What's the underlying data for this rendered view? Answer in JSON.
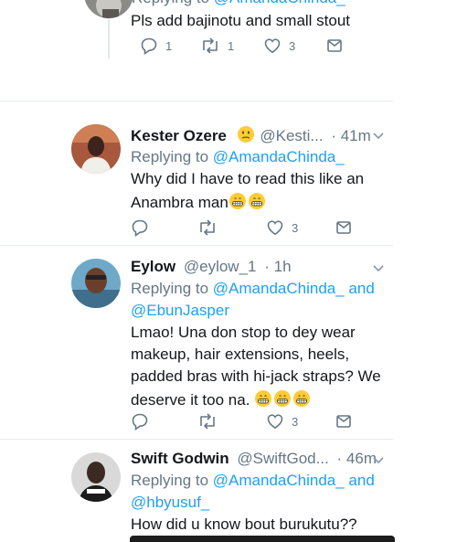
{
  "tweets": [
    {
      "body_lines": [
        "Pls add bajinotu and small stout"
      ],
      "reply_counts": {
        "replies": "1",
        "retweets": "1",
        "likes": "3"
      }
    },
    {
      "name": "Kester Ozere",
      "handle": "@Kesti...",
      "time": "· 41m",
      "replying_prefix": "Replying to ",
      "mentions": [
        "@AmandaChinda_"
      ],
      "body_lines": [
        "Why did I have to read this like an",
        "Anambra man"
      ],
      "counts": {
        "replies": "",
        "retweets": "",
        "likes": "3"
      }
    },
    {
      "name": "Eylow",
      "handle": "@eylow_1",
      "time": "· 1h",
      "replying_prefix": "Replying to ",
      "mention_line1": "@AmandaChinda_",
      "and": " and",
      "mention_line2": "@EbunJasper",
      "body_lines": [
        "Lmao! Una don stop to dey wear",
        "makeup, hair extensions, heels,",
        "padded bras with hi-jack straps? We",
        "deserve it too na. "
      ],
      "counts": {
        "replies": "",
        "retweets": "",
        "likes": "3"
      }
    },
    {
      "name": "Swift Godwin",
      "handle": "@SwiftGod...",
      "time": "· 46m",
      "replying_prefix": "Replying to ",
      "mention_line1": "@AmandaChinda_",
      "and": " and",
      "mention_line2": "@hbyusuf_",
      "body_lines": [
        "How did u know bout burukutu??"
      ]
    }
  ],
  "icons": [
    "reply-icon",
    "retweet-icon",
    "like-icon",
    "dm-icon",
    "chevron-down-icon",
    "grimace-emoji-icon",
    "grinning-emoji-icon"
  ],
  "colors": {
    "name": "#14171a",
    "meta": "#657786",
    "mention": "#1da1f2",
    "separator": "#e6ecf0"
  }
}
